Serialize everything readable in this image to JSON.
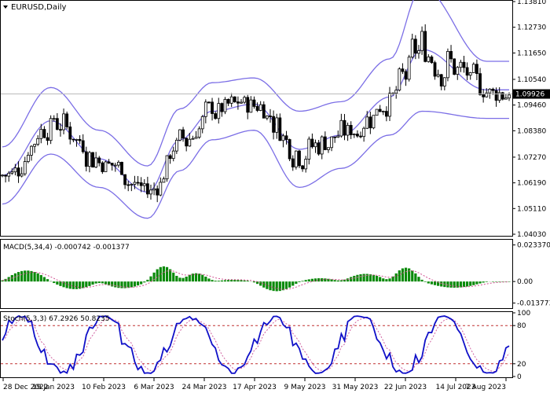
{
  "chart_data": {
    "type": "candlestick",
    "symbol": "EURUSD,Daily",
    "x_ticks": [
      "28 Dec 2022",
      "19 Jan 2023",
      "10 Feb 2023",
      "6 Mar 2023",
      "24 Mar 2023",
      "17 Apr 2023",
      "9 May 2023",
      "31 May 2023",
      "22 Jun 2023",
      "14 Jul 2023",
      "7 Aug 2023"
    ],
    "price_axis": {
      "ticks": [
        "1.13810",
        "1.12730",
        "1.11650",
        "1.10540",
        "1.09460",
        "1.08380",
        "1.07270",
        "1.06190",
        "1.05110",
        "1.04030"
      ],
      "min": 1.0403,
      "max": 1.1381,
      "current_price": "1.09926"
    },
    "bollinger_anchors": {
      "x": [
        0,
        15,
        30,
        45,
        55,
        65,
        78,
        92,
        105,
        120,
        130,
        150
      ],
      "mid": [
        1.065,
        1.088,
        1.072,
        1.058,
        1.08,
        1.092,
        1.095,
        1.076,
        1.082,
        1.098,
        1.118,
        1.101
      ],
      "width": [
        0.012,
        0.014,
        0.012,
        0.011,
        0.013,
        0.012,
        0.011,
        0.016,
        0.014,
        0.016,
        0.026,
        0.012
      ]
    },
    "macd": {
      "label": "MACD(5,34,4) -0.000742 -0.001377",
      "ticks": [
        "0.023370",
        "0.00",
        "-0.013773"
      ],
      "range": [
        -0.0165,
        0.0262
      ]
    },
    "stochastic": {
      "label": "Stoch(5,3,3) 67.2926 50.8235",
      "ticks": [
        "100",
        "80",
        "20",
        "0"
      ],
      "levels": [
        80,
        20
      ]
    },
    "colors": {
      "candles": "#000000",
      "bollinger": "#7b6ee6",
      "macd_hist": "#0a8a0a",
      "macd_signal": "#d05090",
      "stoch_main": "#1010c8",
      "stoch_signal": "#d060a0",
      "levels": "#c03030"
    }
  }
}
